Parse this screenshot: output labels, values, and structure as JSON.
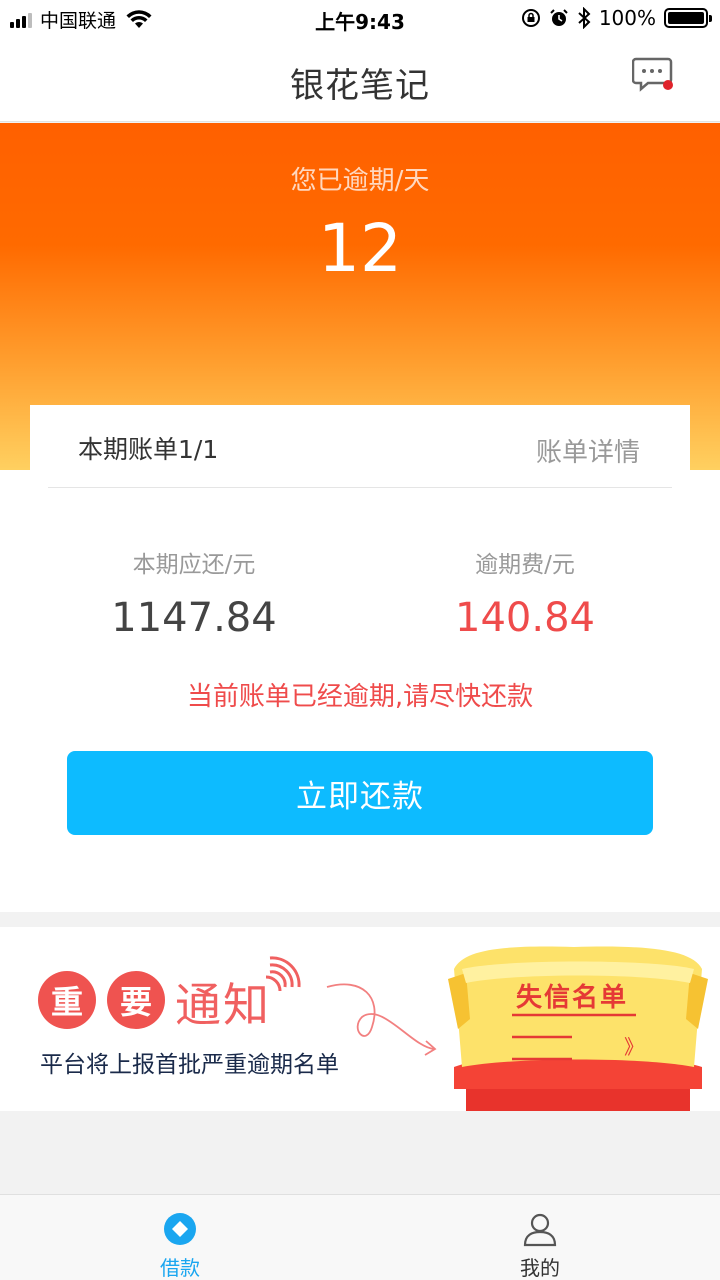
{
  "status_bar": {
    "carrier": "中国联通",
    "time": "上午9:43",
    "battery": "100%"
  },
  "nav": {
    "title": "银花笔记",
    "message_icon": "message-icon"
  },
  "hero": {
    "overdue_label": "您已逾期/天",
    "overdue_days": "12"
  },
  "bill": {
    "period": "本期账单1/1",
    "detail_link": "账单详情",
    "amount_due_label": "本期应还/元",
    "amount_due": "1147.84",
    "late_fee_label": "逾期费/元",
    "late_fee": "140.84",
    "warning": "当前账单已经逾期,请尽快还款",
    "repay_button": "立即还款"
  },
  "banner": {
    "badge_1": "重",
    "badge_2": "要",
    "notice": "通知",
    "subtitle": "平台将上报首批严重逾期名单",
    "blacklist_title": "失信名单",
    "arrow_glyph": "》"
  },
  "tabs": [
    {
      "label": "借款",
      "icon": "loan-icon",
      "active": true
    },
    {
      "label": "我的",
      "icon": "user-icon",
      "active": false
    }
  ],
  "colors": {
    "accent_blue": "#0dbbff",
    "hero_orange": "#ff6000",
    "warning_red": "#ef4b4b"
  }
}
